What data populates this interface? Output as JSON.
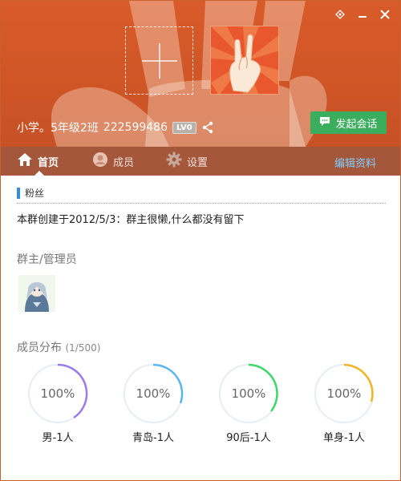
{
  "window": {
    "controls": [
      "restore-icon",
      "minimize-icon",
      "close-icon"
    ]
  },
  "group": {
    "name": "小学。5年级2班",
    "id": "222599486",
    "level": "LV0"
  },
  "header": {
    "chat_button": "发起会话"
  },
  "nav": {
    "tabs": [
      {
        "label": "首页",
        "icon": "home-icon"
      },
      {
        "label": "成员",
        "icon": "user-icon"
      },
      {
        "label": "设置",
        "icon": "gear-icon"
      }
    ],
    "edit_link": "编辑资料"
  },
  "section": {
    "tag": "粉丝"
  },
  "intro": "本群创建于2012/5/3：群主很懒,什么都没有留下",
  "admins": {
    "title": "群主/管理员"
  },
  "distribution": {
    "title": "成员分布",
    "count": "(1/500)",
    "items": [
      {
        "percent": "100%",
        "label": "男-1人",
        "color": "#9b7be8"
      },
      {
        "percent": "100%",
        "label": "青岛-1人",
        "color": "#5ab6ec"
      },
      {
        "percent": "100%",
        "label": "90后-1人",
        "color": "#3ed76a"
      },
      {
        "percent": "100%",
        "label": "单身-1人",
        "color": "#f0b526"
      }
    ]
  },
  "colors": {
    "header": "#d95b2a",
    "nav": "#a4573a",
    "chat_button": "#3bae5e",
    "link": "#7fd0ff"
  }
}
